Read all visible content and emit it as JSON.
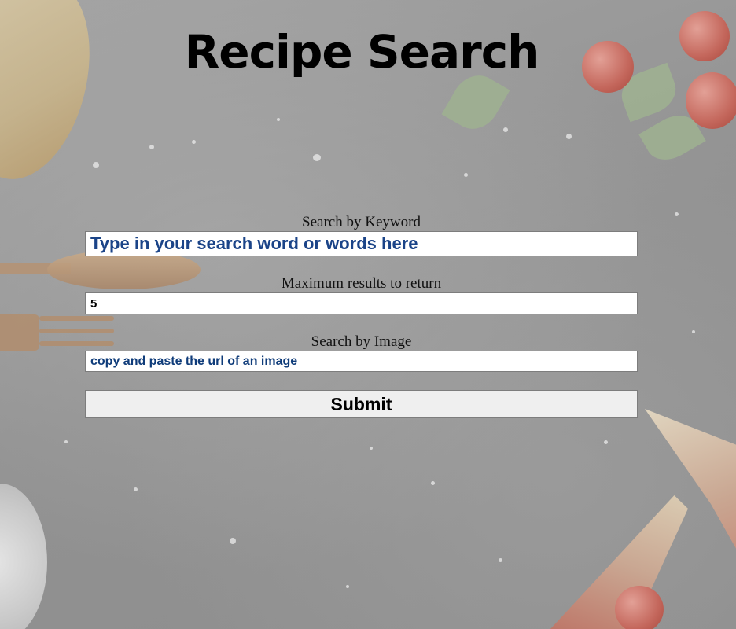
{
  "page": {
    "title": "Recipe Search"
  },
  "form": {
    "keyword": {
      "label": "Search by Keyword",
      "placeholder": "Type in your search word or words here"
    },
    "max_results": {
      "label": "Maximum results to return",
      "value": "5"
    },
    "image": {
      "label": "Search by Image",
      "placeholder": "copy and paste the url of an image"
    },
    "submit_label": "Submit"
  },
  "colors": {
    "placeholder_text": "#1b4488",
    "background": "#9b9b9b",
    "button_bg": "#efefef"
  }
}
